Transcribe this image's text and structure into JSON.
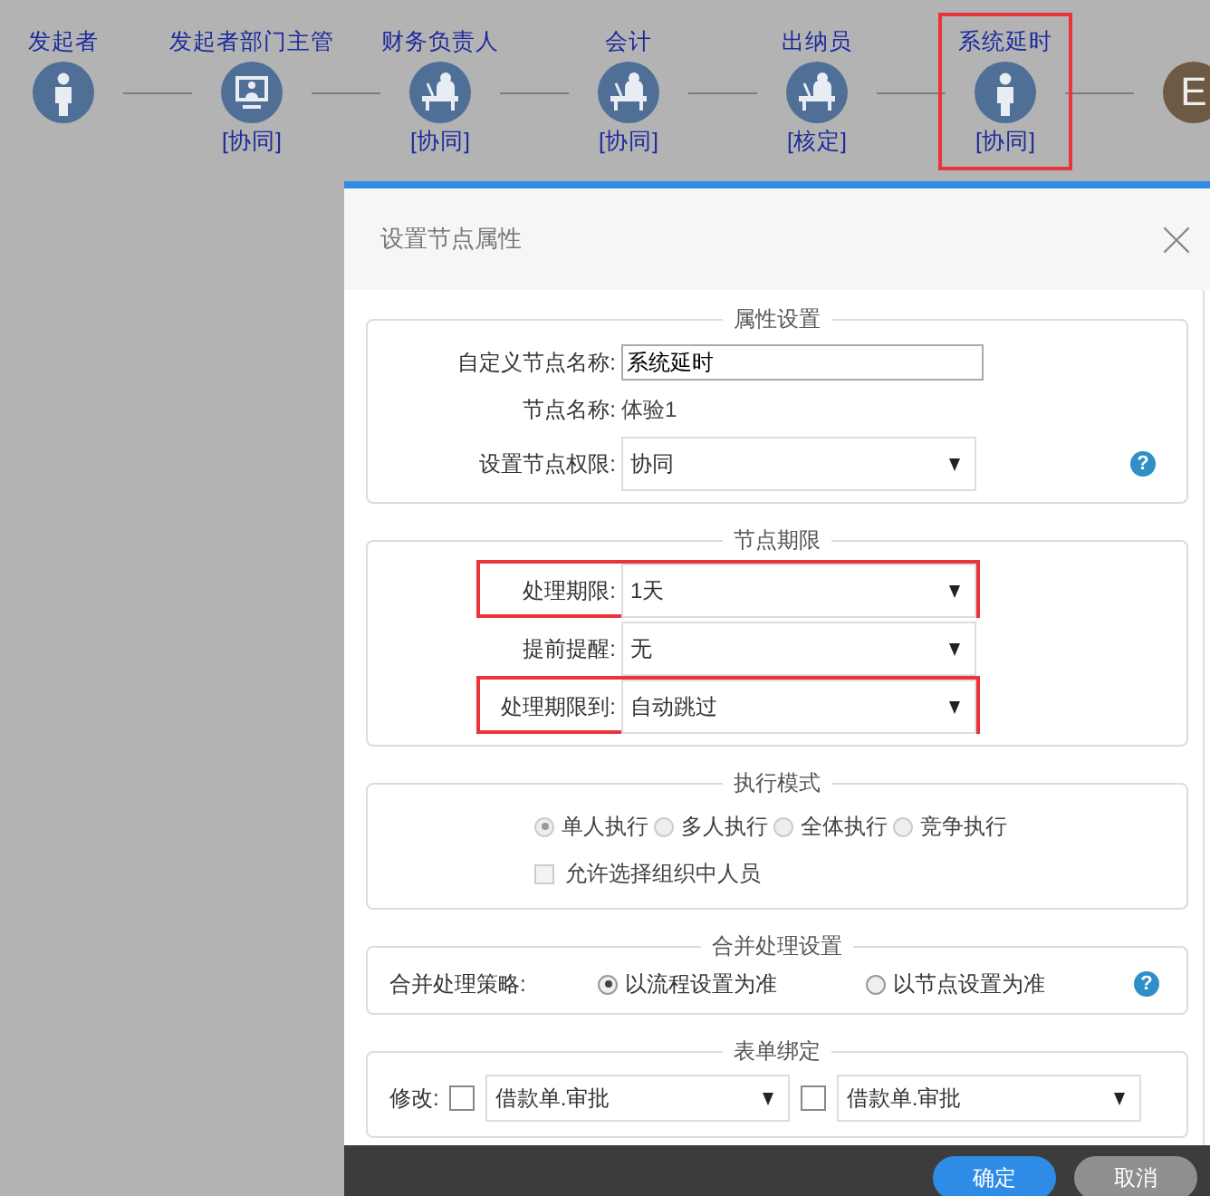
{
  "flow": {
    "nodes": [
      {
        "kind": "person",
        "label": "发起者",
        "highlighted": false
      },
      {
        "kind": "computer",
        "label": "发起者部门主管",
        "role": "[协同]",
        "highlighted": false
      },
      {
        "kind": "desk",
        "label": "财务负责人",
        "role": "[协同]",
        "highlighted": false
      },
      {
        "kind": "desk",
        "label": "会计",
        "role": "[协同]",
        "highlighted": false
      },
      {
        "kind": "desk",
        "label": "出纳员",
        "role": "[核定]",
        "highlighted": false
      },
      {
        "kind": "person",
        "label": "系统延时",
        "role": "[协同]",
        "highlighted": true
      },
      {
        "kind": "end",
        "letter": "E",
        "highlighted": false
      }
    ]
  },
  "dialog": {
    "title": "设置节点属性",
    "sections": [
      {
        "kind": "form",
        "legend": "属性设置",
        "help": "?",
        "rows": [
          {
            "kind": "input",
            "label": "自定义节点名称:",
            "value": "系统延时",
            "highlighted": false
          },
          {
            "kind": "text",
            "label": "节点名称:",
            "value": "体验1",
            "highlighted": false
          },
          {
            "kind": "select",
            "label": "设置节点权限:",
            "value": "协同",
            "highlighted": false
          }
        ]
      },
      {
        "kind": "form",
        "legend": "节点期限",
        "rows": [
          {
            "kind": "select",
            "label": "处理期限:",
            "value": "1天",
            "highlighted": true
          },
          {
            "kind": "select",
            "label": "提前提醒:",
            "value": "无",
            "highlighted": false
          },
          {
            "kind": "select",
            "label": "处理期限到:",
            "value": "自动跳过",
            "highlighted": true
          }
        ]
      },
      {
        "kind": "mode",
        "legend": "执行模式",
        "options": [
          {
            "label": "单人执行",
            "selected": true
          },
          {
            "label": "多人执行",
            "selected": false
          },
          {
            "label": "全体执行",
            "selected": false
          },
          {
            "label": "竞争执行",
            "selected": false
          }
        ],
        "checkbox": {
          "label": "允许选择组织中人员",
          "checked": false
        }
      },
      {
        "kind": "merge",
        "legend": "合并处理设置",
        "label": "合并处理策略:",
        "help": "?",
        "options": [
          {
            "label": "以流程设置为准",
            "selected": true
          },
          {
            "label": "以节点设置为准",
            "selected": false
          }
        ]
      },
      {
        "kind": "binding",
        "legend": "表单绑定",
        "label": "修改:",
        "items": [
          {
            "checked": false,
            "value": "借款单.审批"
          },
          {
            "checked": false,
            "value": "借款单.审批"
          }
        ]
      }
    ],
    "buttons": [
      {
        "label": "确定",
        "primary": true
      },
      {
        "label": "取消",
        "primary": false
      }
    ]
  }
}
